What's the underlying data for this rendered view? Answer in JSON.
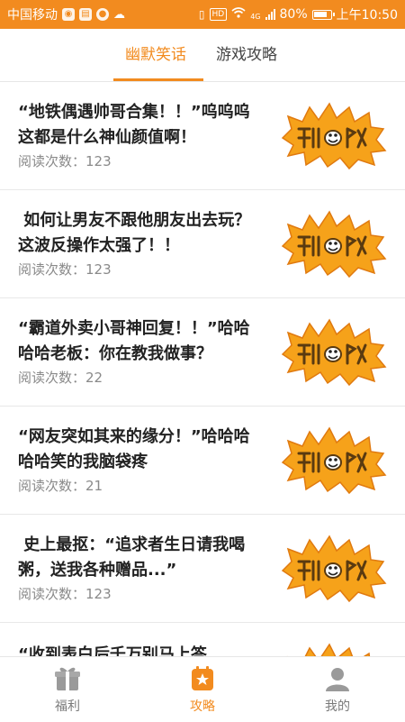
{
  "status_bar": {
    "carrier": "中国移动",
    "network_badge": "HD",
    "signal_type": "4G",
    "battery": "80%",
    "time": "上午10:50",
    "icons": [
      "app-notification-icon",
      "message-icon",
      "globe-icon",
      "cloud-icon",
      "vibrate-icon",
      "hd-icon",
      "wifi-icon",
      "signal-icon",
      "battery-icon"
    ]
  },
  "tabs": [
    {
      "label": "幽默笑话",
      "active": true
    },
    {
      "label": "游戏攻略",
      "active": false
    }
  ],
  "articles": [
    {
      "title": "“地铁偶遇帅哥合集！！”呜呜呜这都是什么神仙颜值啊！",
      "meta_label": "阅读次数：",
      "reads": "123",
      "thumb": "kaixin-sticker-icon"
    },
    {
      "title": " 如何让男友不跟他朋友出去玩？这波反操作太强了！！",
      "meta_label": "阅读次数：",
      "reads": "123",
      "thumb": "kaixin-sticker-icon"
    },
    {
      "title": "“霸道外卖小哥神回复！！”哈哈哈哈老板：你在教我做事？",
      "meta_label": "阅读次数：",
      "reads": "22",
      "thumb": "kaixin-sticker-icon"
    },
    {
      "title": "“网友突如其来的缘分！”哈哈哈哈哈笑的我脑袋疼",
      "meta_label": "阅读次数：",
      "reads": "21",
      "thumb": "kaixin-sticker-icon"
    },
    {
      "title": " 史上最抠：“追求者生日请我喝粥，送我各种赠品...”",
      "meta_label": "阅读次数：",
      "reads": "123",
      "thumb": "kaixin-sticker-icon"
    },
    {
      "title": "“收到表白后千万别马上答",
      "meta_label": "",
      "reads": "",
      "thumb": "kaixin-sticker-icon"
    }
  ],
  "bottom_nav": [
    {
      "label": "福利",
      "icon": "gift-icon",
      "active": false
    },
    {
      "label": "攻略",
      "icon": "guide-icon",
      "active": true
    },
    {
      "label": "我的",
      "icon": "user-icon",
      "active": false
    }
  ],
  "colors": {
    "accent": "#f28b1f",
    "title": "#222222",
    "meta": "#8a8a8a",
    "sticker_fill": "#f6a21a"
  }
}
